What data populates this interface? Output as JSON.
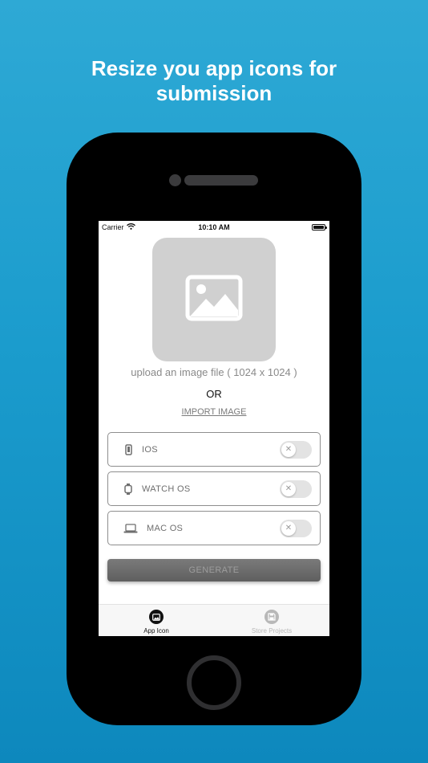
{
  "headline": {
    "line1": "Resize you app icons for",
    "line2": "submission"
  },
  "status_bar": {
    "carrier": "Carrier",
    "time": "10:10 AM"
  },
  "upload": {
    "placeholder_icon": "image-icon",
    "hint": "upload an image file ( 1024 x 1024 )",
    "or_label": "OR",
    "import_label": "IMPORT IMAGE"
  },
  "platforms": [
    {
      "label": "IOS",
      "icon": "phone-icon",
      "enabled": false
    },
    {
      "label": "WATCH OS",
      "icon": "watch-icon",
      "enabled": false
    },
    {
      "label": "MAC OS",
      "icon": "laptop-icon",
      "enabled": false
    }
  ],
  "generate_label": "GENERATE",
  "tabs": [
    {
      "label": "App Icon",
      "icon": "image-icon",
      "active": true
    },
    {
      "label": "Store Projects",
      "icon": "floppy-disk-icon",
      "active": false
    }
  ],
  "colors": {
    "background_top": "#2ea9d5",
    "background_bottom": "#0d88bd",
    "placeholder": "#d0d0d0",
    "button": "#6b6b6b"
  }
}
